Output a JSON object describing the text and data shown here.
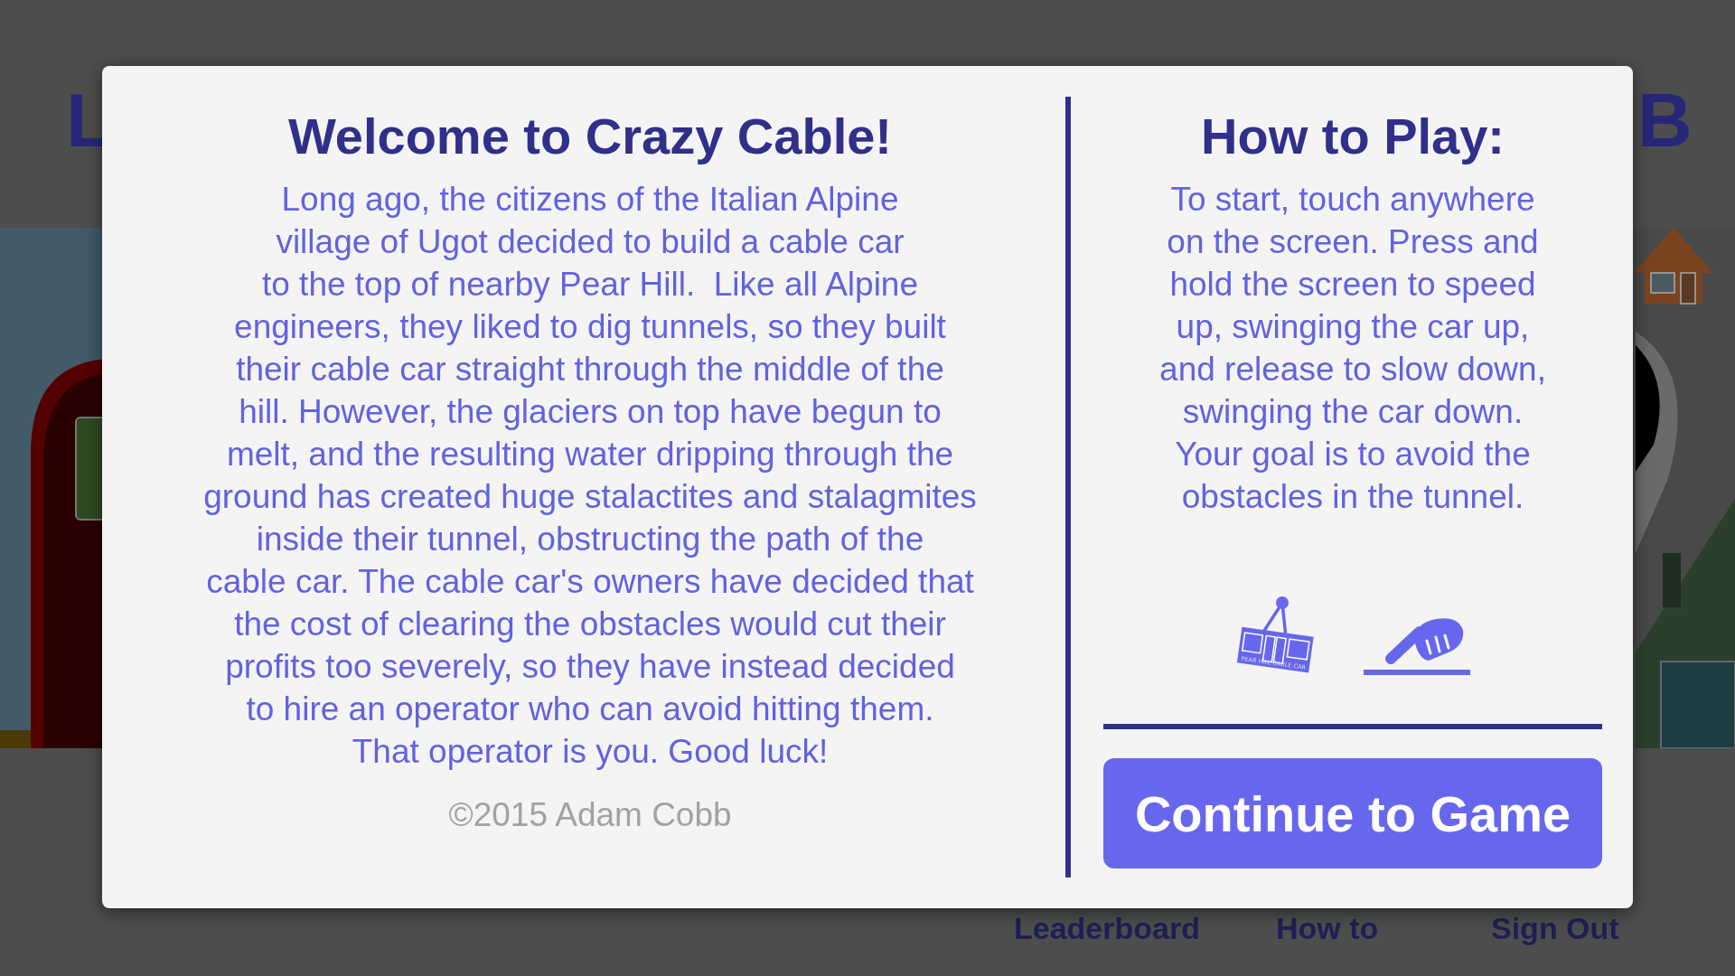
{
  "header": {
    "title_left": "L",
    "title_right": "B"
  },
  "dialog": {
    "intro": {
      "title": "Welcome to Crazy Cable!",
      "lines": [
        "Long ago, the citizens of the Italian Alpine",
        "village of Ugot decided to build a cable car",
        "to the top of nearby Pear Hill.  Like all Alpine",
        "engineers, they liked to dig tunnels, so they built",
        "their cable car straight through the middle of the",
        "hill. However, the glaciers on top have begun to",
        "melt, and the resulting water dripping through the",
        "ground has created huge stalactites and stalagmites",
        "inside their tunnel, obstructing the path of the",
        "cable car. The cable car's owners have decided that",
        "the cost of clearing the obstacles would cut their",
        "profits too severely, so they have instead decided",
        "to hire an operator who can avoid hitting them.",
        "That operator is you. Good luck!"
      ],
      "copyright": "©2015 Adam Cobb"
    },
    "how_to": {
      "title": "How to Play:",
      "lines": [
        "To start, touch anywhere",
        "on the screen. Press and",
        "hold the screen to speed",
        "up, swinging the car up,",
        "and release to slow down,",
        "swinging the car down.",
        "Your goal is to avoid the",
        "obstacles in the tunnel."
      ],
      "cable_car_sign": "PEAR HILL CABLE CAR"
    },
    "button": "Continue to Game"
  },
  "footer_links": [
    "Leaderboard",
    "How to",
    "Sign Out"
  ]
}
